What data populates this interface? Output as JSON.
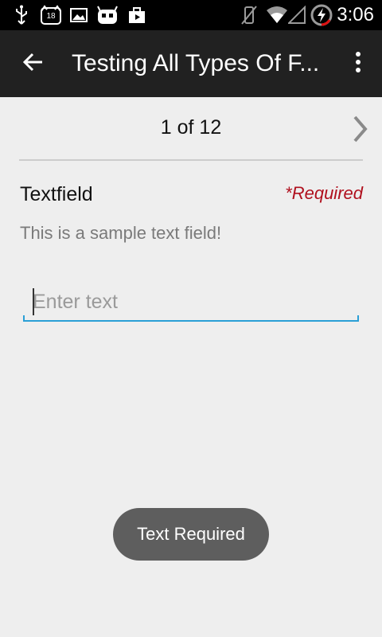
{
  "status_bar": {
    "time": "3:06",
    "notification_badge": "18",
    "icons": [
      "usb-icon",
      "notification-18-icon",
      "image-icon",
      "android-icon",
      "briefcase-icon",
      "mute-icon",
      "wifi-icon",
      "signal-icon",
      "battery-charging-icon"
    ]
  },
  "action_bar": {
    "title": "Testing All Types Of F...",
    "back_icon": "arrow-back-icon",
    "overflow_icon": "more-vert-icon"
  },
  "pager": {
    "text": "1 of 12",
    "next_icon": "chevron-right-icon"
  },
  "field": {
    "label": "Textfield",
    "required_label": "*Required",
    "hint": "This is a sample text field!",
    "placeholder": "Enter text",
    "value": ""
  },
  "toast": {
    "message": "Text Required"
  },
  "colors": {
    "background": "#eeeeee",
    "action_bar": "#212121",
    "required": "#b0101e",
    "input_accent": "#2a9fd6",
    "toast": "#5e5e5e"
  }
}
